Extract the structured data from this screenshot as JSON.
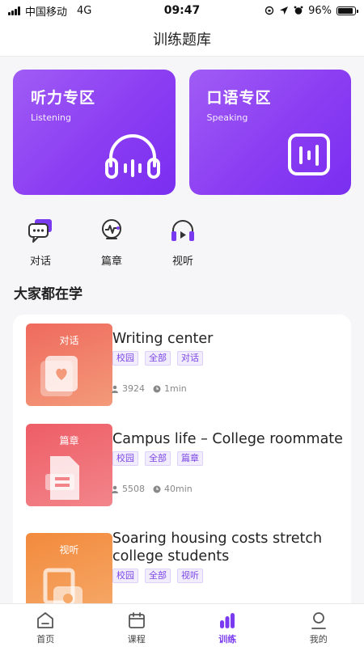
{
  "status": {
    "carrier": "中国移动",
    "network": "4G",
    "time": "09:47",
    "battery": "96%"
  },
  "nav": {
    "title": "训练题库"
  },
  "zones": [
    {
      "title": "听力专区",
      "subtitle": "Listening",
      "icon": "headphones-icon"
    },
    {
      "title": "口语专区",
      "subtitle": "Speaking",
      "icon": "voice-wave-icon"
    }
  ],
  "categories": [
    {
      "label": "对话",
      "icon": "chat-bubbles-icon"
    },
    {
      "label": "篇章",
      "icon": "pulse-bubble-icon"
    },
    {
      "label": "视听",
      "icon": "headphone-play-icon"
    }
  ],
  "section": {
    "title": "大家都在学"
  },
  "courses": [
    {
      "badge": "对话",
      "title": "Writing center",
      "tags": [
        "校园",
        "全部",
        "对话"
      ],
      "learners": "3924",
      "duration": "1min",
      "color": "#ef6a5d"
    },
    {
      "badge": "篇章",
      "title": "Campus life – College roommate",
      "tags": [
        "校园",
        "全部",
        "篇章"
      ],
      "learners": "5508",
      "duration": "40min",
      "color": "#ee5d66"
    },
    {
      "badge": "视听",
      "title": "Soaring housing costs stretch college students",
      "tags": [
        "校园",
        "全部",
        "视听"
      ],
      "color": "#f28a3c"
    }
  ],
  "tabs": [
    {
      "label": "首页",
      "icon": "home-icon"
    },
    {
      "label": "课程",
      "icon": "calendar-icon"
    },
    {
      "label": "训练",
      "icon": "bar-chart-icon",
      "active": true
    },
    {
      "label": "我的",
      "icon": "user-icon"
    }
  ],
  "colors": {
    "accent": "#7a3af0",
    "tag_text": "#7b46e6"
  }
}
